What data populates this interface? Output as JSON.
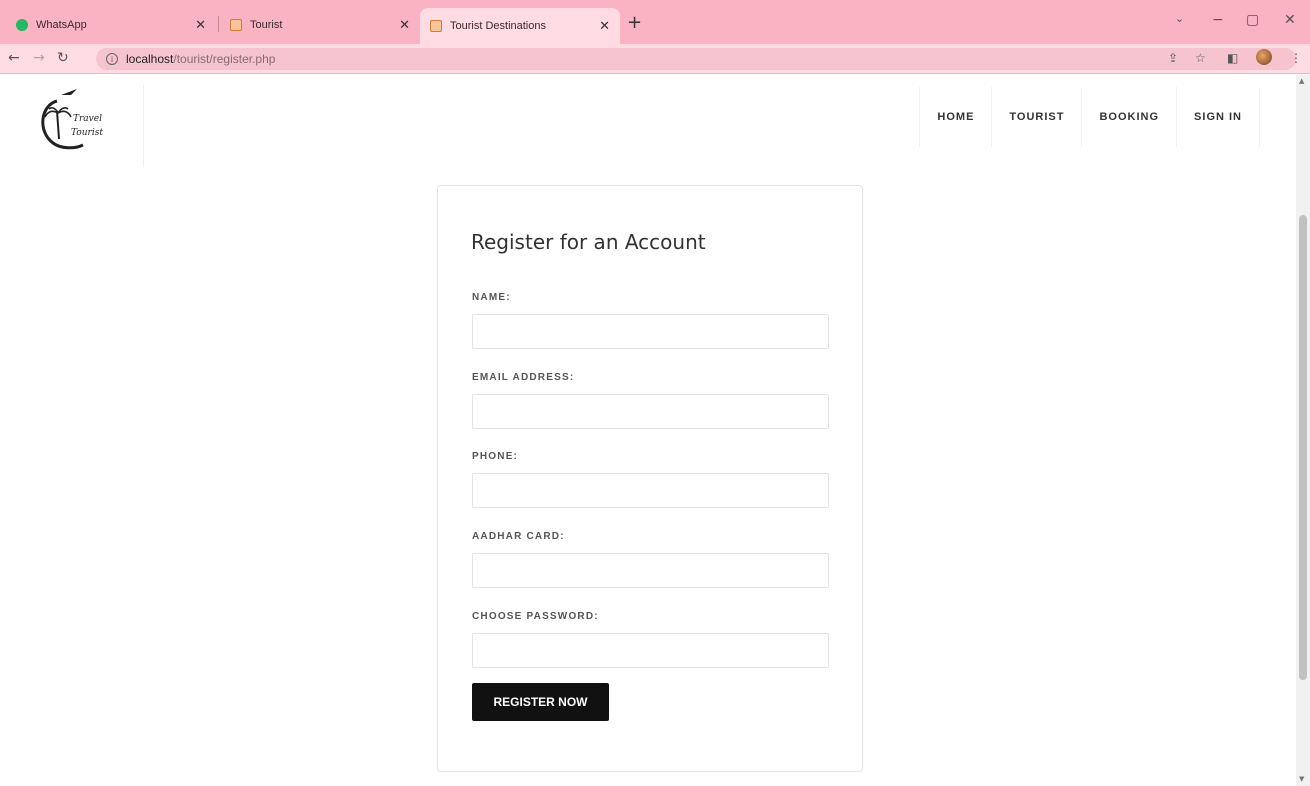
{
  "browser": {
    "tabs": [
      {
        "title": "WhatsApp",
        "active": false
      },
      {
        "title": "Tourist",
        "active": false
      },
      {
        "title": "Tourist Destinations",
        "active": true
      }
    ],
    "new_tab_label": "+",
    "window_controls": {
      "minimize": "−",
      "restore": "▢",
      "close": "✕"
    },
    "dropdown": "⌄",
    "address": {
      "host": "localhost",
      "path": "/tourist/register.php"
    }
  },
  "site": {
    "logo": {
      "line1": "Travel",
      "line2": "Tourist"
    },
    "nav": [
      "HOME",
      "TOURIST",
      "BOOKING",
      "SIGN IN"
    ]
  },
  "form": {
    "title": "Register for an Account",
    "fields": [
      {
        "label": "NAME:",
        "value": "",
        "placeholder": ""
      },
      {
        "label": "EMAIL ADDRESS:",
        "value": "",
        "placeholder": ""
      },
      {
        "label": "PHONE:",
        "value": "",
        "placeholder": ""
      },
      {
        "label": "AADHAR CARD:",
        "value": "",
        "placeholder": ""
      },
      {
        "label": "CHOOSE PASSWORD:",
        "value": "",
        "placeholder": ""
      }
    ],
    "submit_label": "REGISTER NOW"
  },
  "colors": {
    "tabbar": "#f9b3c2",
    "toolbar": "#ffdbe3",
    "button": "#111111"
  }
}
